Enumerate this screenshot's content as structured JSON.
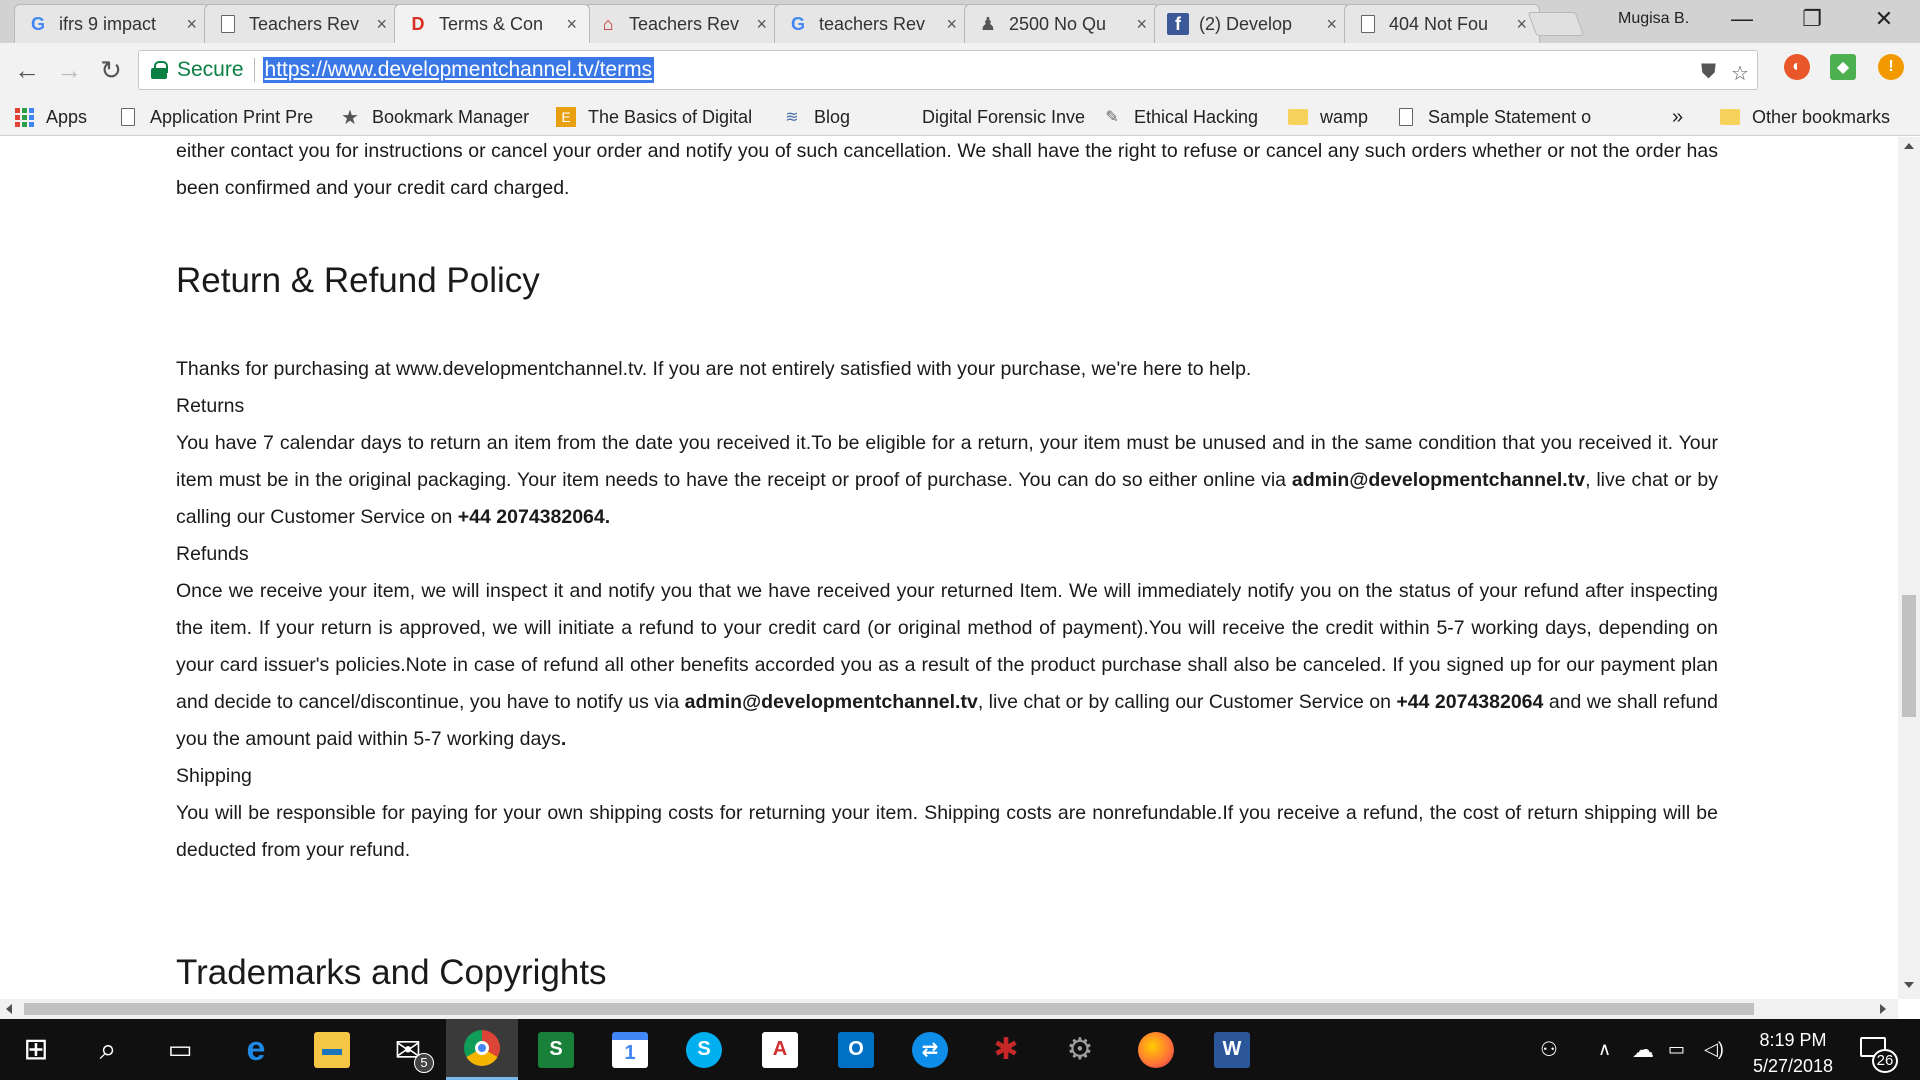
{
  "tabs": [
    {
      "label": "ifrs 9 impact",
      "icon": "google-icon",
      "color": "#4285f4"
    },
    {
      "label": "Teachers Rev",
      "icon": "page-icon",
      "color": "#555555"
    },
    {
      "label": "Terms & Con",
      "icon": "development-channel-icon",
      "color": "#d93025"
    },
    {
      "label": "Teachers Rev",
      "icon": "school-icon",
      "color": "#c62828"
    },
    {
      "label": "teachers Rev",
      "icon": "google-icon",
      "color": "#4285f4"
    },
    {
      "label": "2500 No Qu",
      "icon": "group-icon",
      "color": "#555555"
    },
    {
      "label": "(2) Develop",
      "icon": "facebook-icon",
      "color": "#3b5998"
    },
    {
      "label": "404 Not Fou",
      "icon": "page-icon",
      "color": "#555555"
    }
  ],
  "tab_close_glyph": "×",
  "profile_name": "Mugisa B.",
  "window": {
    "minimize": "—",
    "restore": "❐",
    "close": "✕"
  },
  "toolbar": {
    "back": "←",
    "forward": "→",
    "reload": "↻",
    "secure_label": "Secure",
    "url": "https://www.developmentchannel.tv/terms",
    "star": "☆"
  },
  "bookmarks": {
    "items": [
      {
        "label": "Apps",
        "icon": "apps-grid-icon"
      },
      {
        "label": "Application Print Pre",
        "icon": "page-icon"
      },
      {
        "label": "Bookmark Manager",
        "icon": "star-icon"
      },
      {
        "label": "The Basics of Digital",
        "icon": "ebook-icon"
      },
      {
        "label": "Blog",
        "icon": "wifi-icon"
      },
      {
        "label": "Digital Forensic Inve",
        "icon": "blank-icon"
      },
      {
        "label": "Ethical Hacking",
        "icon": "tool-icon"
      },
      {
        "label": "wamp",
        "icon": "folder-icon"
      },
      {
        "label": "Sample Statement o",
        "icon": "page-icon"
      }
    ],
    "overflow": "»",
    "other": "Other bookmarks"
  },
  "content": {
    "intro_line1": "either contact you for instructions or cancel your order and notify you of such cancellation. We shall have the right to refuse or cancel any such orders whether or not the order",
    "intro_line2": "has been confirmed and your credit card charged.",
    "refund_heading": "Return & Refund Policy",
    "thanks": "Thanks for purchasing at www.developmentchannel.tv. If you are not entirely satisfied with your purchase, we're here to help.",
    "returns_label": "Returns",
    "returns_text": "You have 7 calendar days to return an item from the date you received it.To be eligible for a return, your item must be unused and in the same condition that you received it. Your item must be in the original packaging. Your item needs to have the receipt or proof of purchase. You can do so either online via",
    "returns_email": "admin@developmentchannel.tv",
    "returns_text2": ", live chat or by calling our Customer Service on",
    "returns_phone": "+44 2074382064.",
    "refunds_label": "Refunds",
    "refunds_text": "Once we receive your item, we will inspect it and notify you that we have received your returned Item. We will immediately notify you on the status of your refund after inspecting the item. If your return is approved, we will initiate a refund to your credit card (or original method of payment).You will receive the credit within 5-7 working days, depending on your card issuer's policies.Note in case of refund all other benefits accorded you as a result of the product purchase shall also be canceled. If you signed up for our payment plan and decide to cancel/discontinue, you have to notify us via",
    "refunds_email": "admin@developmentchannel.tv",
    "refunds_text2": ", live chat or by calling our Customer Service on",
    "refunds_phone": "+44 2074382064",
    "refunds_text3": "and we shall refund you the amount paid within 5-7 working days",
    "refunds_period": ".",
    "shipping_label": "Shipping",
    "shipping_text": "You will be responsible for paying for your own shipping costs for returning your item. Shipping costs are nonrefundable.If you receive a refund, the cost of return shipping will be deducted from your refund.",
    "trademarks_heading": "Trademarks and Copyrights"
  },
  "taskbar": {
    "apps": [
      {
        "name": "windows-start-icon",
        "glyph": "⊞",
        "color": "#ffffff"
      },
      {
        "name": "search-icon",
        "glyph": "⌕",
        "color": "#ffffff"
      },
      {
        "name": "task-view-icon",
        "glyph": "▭",
        "color": "#ffffff"
      },
      {
        "name": "edge-icon",
        "glyph": "e",
        "color": "#1e88e5"
      },
      {
        "name": "file-explorer-icon",
        "glyph": "▬",
        "color": "#f6c744"
      },
      {
        "name": "mail-icon",
        "glyph": "✉",
        "color": "#ffffff"
      },
      {
        "name": "chrome-icon",
        "glyph": "◉",
        "color": "#4caf50"
      },
      {
        "name": "sheets-icon",
        "glyph": "S",
        "color": "#188038"
      },
      {
        "name": "calendar-icon",
        "glyph": "1",
        "color": "#4285f4"
      },
      {
        "name": "skype-icon",
        "glyph": "S",
        "color": "#00aff0"
      },
      {
        "name": "acrobat-icon",
        "glyph": "A",
        "color": "#d32f2f"
      },
      {
        "name": "outlook-icon",
        "glyph": "O",
        "color": "#0072c6"
      },
      {
        "name": "teamviewer-icon",
        "glyph": "⇄",
        "color": "#0e8ee9"
      },
      {
        "name": "spider-app-icon",
        "glyph": "✱",
        "color": "#c62828"
      },
      {
        "name": "tools-app-icon",
        "glyph": "⚙",
        "color": "#9e9e9e"
      },
      {
        "name": "firefox-icon",
        "glyph": "◍",
        "color": "#ff7139"
      },
      {
        "name": "word-icon",
        "glyph": "W",
        "color": "#2b579a"
      }
    ],
    "mail_badge": "5",
    "time": "8:19 PM",
    "date": "5/27/2018",
    "notification_count": "26"
  }
}
